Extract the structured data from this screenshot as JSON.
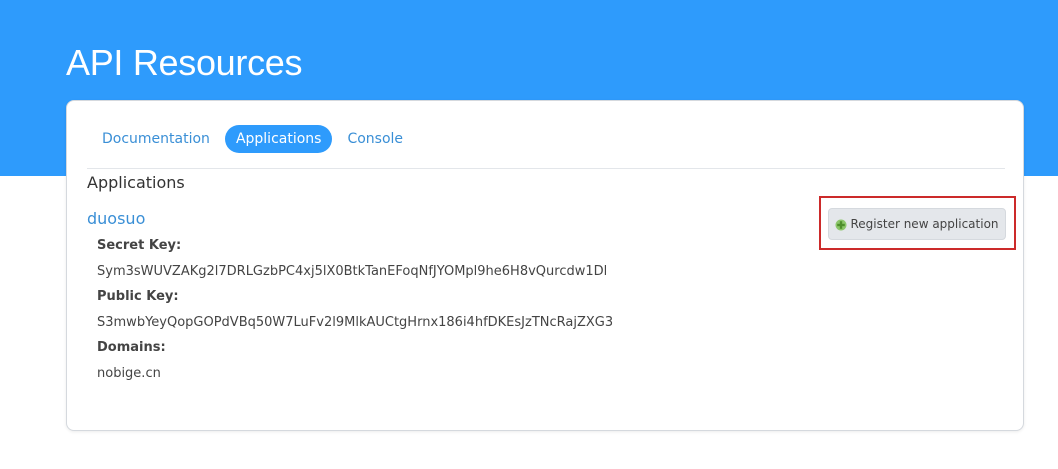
{
  "page": {
    "title": "API Resources"
  },
  "tabs": [
    {
      "label": "Documentation",
      "active": false
    },
    {
      "label": "Applications",
      "active": true
    },
    {
      "label": "Console",
      "active": false
    }
  ],
  "section": {
    "heading": "Applications"
  },
  "application": {
    "name": "duosuo",
    "secret_key_label": "Secret Key:",
    "secret_key": "Sym3sWUVZAKg2l7DRLGzbPC4xj5lX0BtkTanEFoqNfJYOMpl9he6H8vQurcdw1Dl",
    "public_key_label": "Public Key:",
    "public_key": "S3mwbYeyQopGOPdVBq50W7LuFv2l9MlkAUCtgHrnx186i4hfDKEsJzTNcRajZXG3",
    "domains_label": "Domains:",
    "domains": "nobige.cn"
  },
  "actions": {
    "register_label": "Register new application",
    "register_icon": "plus-icon"
  },
  "colors": {
    "header_blue": "#2e9bfc",
    "link_blue": "#3a8fd6",
    "highlight_red": "#cc2a2a",
    "plus_green": "#5aa33a"
  }
}
